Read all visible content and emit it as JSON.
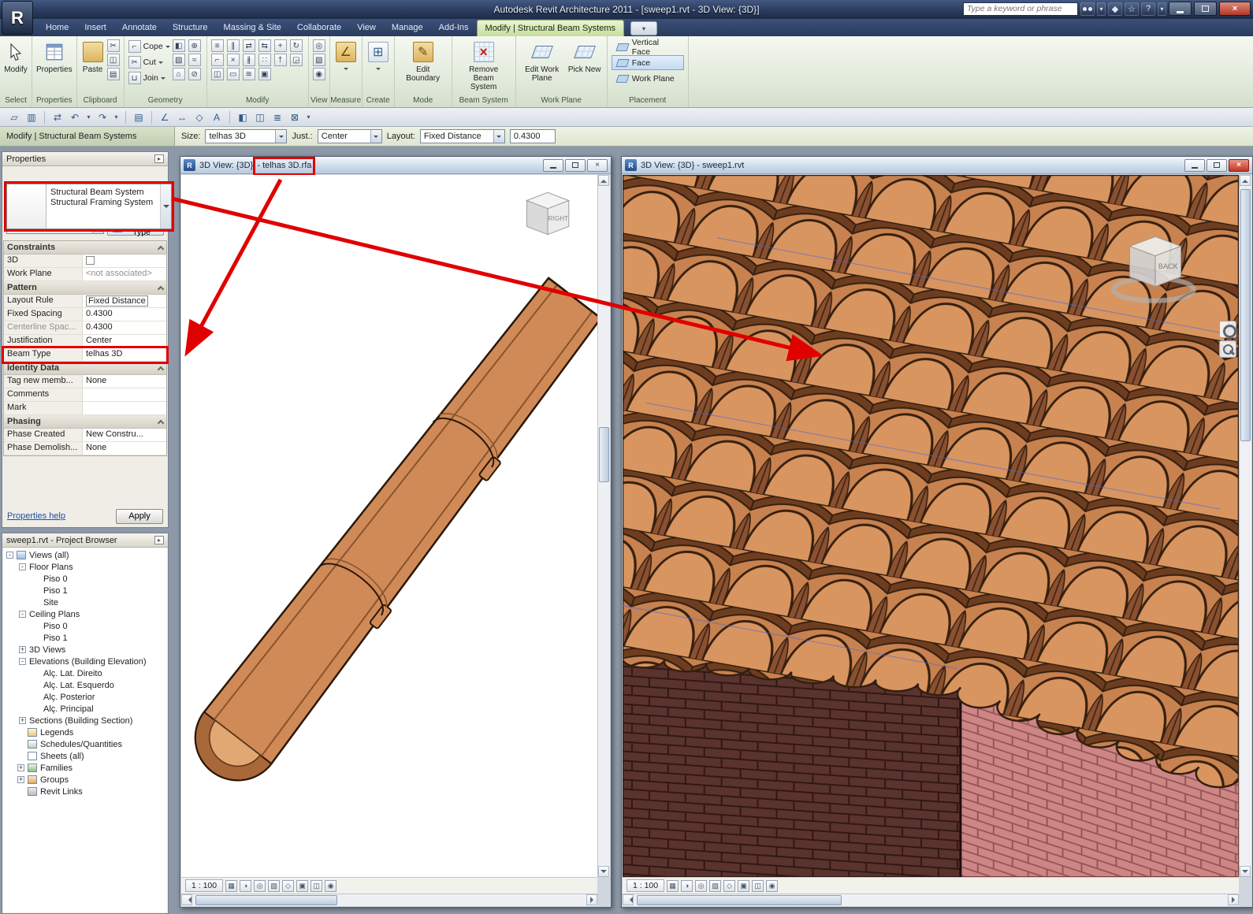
{
  "colors": {
    "annotation_red": "#e00000",
    "tab_active_green": "#c7dd9b",
    "tile_terracotta": "#cf8a57",
    "wall_dark": "#5a332e",
    "wall_pink": "#cd8585"
  },
  "titlebar": {
    "title": "Autodesk Revit Architecture 2011 - [sweep1.rvt - 3D View: {3D}]",
    "search_placeholder": "Type a keyword or phrase",
    "close_glyph": "×"
  },
  "titlebar_icons": [
    {
      "g": "",
      "n": "search-binoculars-icon",
      "cls": "tbi bino-box"
    },
    {
      "g": "▾",
      "n": "search-scope-dropdown-icon",
      "cls": "tbi tsm"
    },
    {
      "g": "◆",
      "n": "subscription-center-icon",
      "cls": "tbi"
    },
    {
      "g": "☆",
      "n": "favorites-icon",
      "cls": "tbi"
    },
    {
      "g": "?",
      "n": "help-icon",
      "cls": "tbi"
    },
    {
      "g": "▾",
      "n": "help-dropdown-icon",
      "cls": "tbi tsm"
    }
  ],
  "app_button": {
    "glyph": "R"
  },
  "tabs": [
    {
      "label": "Home",
      "cls": "tab",
      "n": "tab-home"
    },
    {
      "label": "Insert",
      "cls": "tab",
      "n": "tab-insert"
    },
    {
      "label": "Annotate",
      "cls": "tab",
      "n": "tab-annotate"
    },
    {
      "label": "Structure",
      "cls": "tab",
      "n": "tab-structure"
    },
    {
      "label": "Massing & Site",
      "cls": "tab",
      "n": "tab-massing-site"
    },
    {
      "label": "Collaborate",
      "cls": "tab",
      "n": "tab-collaborate"
    },
    {
      "label": "View",
      "cls": "tab",
      "n": "tab-view"
    },
    {
      "label": "Manage",
      "cls": "tab",
      "n": "tab-manage"
    },
    {
      "label": "Add-Ins",
      "cls": "tab",
      "n": "tab-add-ins"
    },
    {
      "label": "Modify | Structural Beam Systems",
      "cls": "tab active",
      "n": "tab-modify-structural-beam-systems"
    },
    {
      "label": "▾",
      "cls": "tabx",
      "n": "ribbon-display-toggle"
    }
  ],
  "ribbon": {
    "panels": {
      "select": "Select",
      "properties": "Properties",
      "clipboard": "Clipboard",
      "geometry": "Geometry",
      "modify": "Modify",
      "view": "View",
      "measure": "Measure",
      "create": "Create",
      "mode": "Mode",
      "beam_system": "Beam System",
      "work_plane": "Work Plane",
      "placement": "Placement"
    },
    "buttons": {
      "modify": "Modify",
      "properties": "Properties",
      "paste": "Paste",
      "cope": "Cope",
      "cut": "Cut",
      "join": "Join",
      "edit_boundary": "Edit Boundary",
      "remove_beam_system": "Remove Beam System",
      "edit_work_plane": "Edit Work Plane",
      "pick_new": "Pick New"
    },
    "glyphs": {
      "pencil": "✎",
      "remove_x": "×",
      "create": "⊞",
      "measure": "∠",
      "cope": "⌐",
      "cut": "✂",
      "join": "⊔"
    },
    "clipboard_icons": [
      {
        "g": "✂",
        "n": "cut-to-clipboard-icon"
      },
      {
        "g": "◫",
        "n": "copy-to-clipboard-icon"
      },
      {
        "g": "▤",
        "n": "match-type-properties-icon"
      }
    ],
    "geometry_icons": [
      {
        "g": "◧",
        "n": "paint-icon"
      },
      {
        "g": "⊕",
        "n": "join-geometry-icon"
      },
      {
        "g": "▨",
        "n": "demolish-icon"
      },
      {
        "g": "≈",
        "n": "split-face-icon"
      },
      {
        "g": "⌂",
        "n": "wall-joins-icon"
      },
      {
        "g": "⊘",
        "n": "unjoin-icon"
      }
    ],
    "modify_icons": [
      {
        "g": "≡",
        "n": "align-icon"
      },
      {
        "g": "∥",
        "n": "offset-icon"
      },
      {
        "g": "⇄",
        "n": "mirror-pick-axis-icon"
      },
      {
        "g": "⇆",
        "n": "mirror-draw-axis-icon"
      },
      {
        "g": "+",
        "n": "move-icon"
      },
      {
        "g": "↻",
        "n": "rotate-icon"
      },
      {
        "g": "⌐",
        "n": "trim-extend-icon"
      },
      {
        "g": "×",
        "n": "delete-icon"
      },
      {
        "g": "∦",
        "n": "split-element-icon"
      },
      {
        "g": "∷",
        "n": "array-icon"
      },
      {
        "g": "†",
        "n": "pin-icon"
      },
      {
        "g": "◲",
        "n": "scale-icon"
      },
      {
        "g": "◫",
        "n": "copy-icon"
      },
      {
        "g": "▭",
        "n": "unpin-icon"
      },
      {
        "g": "≋",
        "n": "match-icon"
      },
      {
        "g": "▣",
        "n": "activate-controls-icon"
      }
    ],
    "view_icons": [
      {
        "g": "◎",
        "n": "reveal-hidden-elements-icon"
      },
      {
        "g": "▨",
        "n": "hide-element-icon"
      },
      {
        "g": "◉",
        "n": "visibility-settings-icon"
      }
    ],
    "placement_options": [
      {
        "label": "Vertical Face",
        "cls": "place-item",
        "n": "placement-vertical-face"
      },
      {
        "label": "Face",
        "cls": "place-item selected",
        "n": "placement-face"
      },
      {
        "label": "Work Plane",
        "cls": "place-item",
        "n": "placement-work-plane"
      }
    ]
  },
  "qat_icons": [
    {
      "g": "▱",
      "n": "open-icon",
      "cls": "qi"
    },
    {
      "g": "▥",
      "n": "save-icon",
      "cls": "qi"
    },
    {
      "g": "",
      "n": "separator",
      "cls": "qsep"
    },
    {
      "g": "⇄",
      "n": "sync-with-central-icon",
      "cls": "qi"
    },
    {
      "g": "↶",
      "n": "undo-icon",
      "cls": "qi"
    },
    {
      "g": "▾",
      "n": "undo-dropdown-icon",
      "cls": "qi qdd"
    },
    {
      "g": "↷",
      "n": "redo-icon",
      "cls": "qi"
    },
    {
      "g": "▾",
      "n": "redo-dropdown-icon",
      "cls": "qi qdd"
    },
    {
      "g": "",
      "n": "separator",
      "cls": "qsep"
    },
    {
      "g": "▤",
      "n": "print-icon",
      "cls": "qi"
    },
    {
      "g": "",
      "n": "separator",
      "cls": "qsep"
    },
    {
      "g": "∠",
      "n": "measure-icon",
      "cls": "qi"
    },
    {
      "g": "↔",
      "n": "aligned-dimension-icon",
      "cls": "qi"
    },
    {
      "g": "◇",
      "n": "tag-by-category-icon",
      "cls": "qi"
    },
    {
      "g": "A",
      "n": "text-icon",
      "cls": "qi"
    },
    {
      "g": "",
      "n": "separator",
      "cls": "qsep"
    },
    {
      "g": "◧",
      "n": "default-3d-view-icon",
      "cls": "qi"
    },
    {
      "g": "◫",
      "n": "section-icon",
      "cls": "qi"
    },
    {
      "g": "≣",
      "n": "thin-lines-icon",
      "cls": "qi"
    },
    {
      "g": "⊠",
      "n": "close-hidden-windows-icon",
      "cls": "qi"
    },
    {
      "g": "▾",
      "n": "switch-windows-dropdown-icon",
      "cls": "qi qdd"
    }
  ],
  "options_bar": {
    "mode_label": "Modify | Structural Beam Systems",
    "size_label": "Size:",
    "size_value": "telhas 3D",
    "just_label": "Just.:",
    "just_value": "Center",
    "layout_label": "Layout:",
    "layout_value": "Fixed Distance",
    "spacing_value": "0.4300"
  },
  "properties_panel": {
    "header": "Properties",
    "type_family": "Structural Beam System",
    "type_name": "Structural Framing System",
    "selector_value": "Structural Beam Sys",
    "edit_type": "Edit Type",
    "help_link": "Properties help",
    "apply": "Apply",
    "groups": {
      "constraints": "Constraints",
      "pattern": "Pattern",
      "identity": "Identity Data",
      "phasing": "Phasing"
    },
    "rows": {
      "c3d": {
        "k": "3D",
        "v": ""
      },
      "work_plane": {
        "k": "Work Plane",
        "v": "<not associated>"
      },
      "layout_rule": {
        "k": "Layout Rule",
        "v": "Fixed Distance"
      },
      "fixed_spacing": {
        "k": "Fixed Spacing",
        "v": "0.4300"
      },
      "centerline": {
        "k": "Centerline Spac...",
        "v": "0.4300"
      },
      "justification": {
        "k": "Justification",
        "v": "Center"
      },
      "beam_type": {
        "k": "Beam Type",
        "v": "telhas 3D"
      },
      "tag_new": {
        "k": "Tag new memb...",
        "v": "None"
      },
      "comments": {
        "k": "Comments",
        "v": ""
      },
      "mark": {
        "k": "Mark",
        "v": ""
      },
      "phase_created": {
        "k": "Phase Created",
        "v": "New Constru..."
      },
      "phase_demo": {
        "k": "Phase Demolish...",
        "v": "None"
      }
    }
  },
  "project_browser": {
    "header": "sweep1.rvt - Project Browser",
    "items": [
      {
        "label": "Views (all)",
        "cls": "titem l0",
        "exp": "-",
        "icn": "ticn icn-views"
      },
      {
        "label": "Floor Plans",
        "cls": "titem l1",
        "exp": "-",
        "icn": "ticn none"
      },
      {
        "label": "Piso 0",
        "cls": "titem l2",
        "exp": "",
        "icn": "ticn none"
      },
      {
        "label": "Piso 1",
        "cls": "titem l2",
        "exp": "",
        "icn": "ticn none"
      },
      {
        "label": "Site",
        "cls": "titem l2",
        "exp": "",
        "icn": "ticn none"
      },
      {
        "label": "Ceiling Plans",
        "cls": "titem l1",
        "exp": "-",
        "icn": "ticn none"
      },
      {
        "label": "Piso 0",
        "cls": "titem l2",
        "exp": "",
        "icn": "ticn none"
      },
      {
        "label": "Piso 1",
        "cls": "titem l2",
        "exp": "",
        "icn": "ticn none"
      },
      {
        "label": "3D Views",
        "cls": "titem l1",
        "exp": "+",
        "icn": "ticn none"
      },
      {
        "label": "Elevations (Building Elevation)",
        "cls": "titem l1",
        "exp": "-",
        "icn": "ticn none"
      },
      {
        "label": "Alç. Lat. Direito",
        "cls": "titem l2",
        "exp": "",
        "icn": "ticn none"
      },
      {
        "label": "Alç. Lat. Esquerdo",
        "cls": "titem l2",
        "exp": "",
        "icn": "ticn none"
      },
      {
        "label": "Alç. Posterior",
        "cls": "titem l2",
        "exp": "",
        "icn": "ticn none"
      },
      {
        "label": "Alç. Principal",
        "cls": "titem l2",
        "exp": "",
        "icn": "ticn none"
      },
      {
        "label": "Sections (Building Section)",
        "cls": "titem l1",
        "exp": "+",
        "icn": "ticn none"
      },
      {
        "label": "Legends",
        "cls": "titem l0i",
        "exp": "",
        "icn": "ticn icn-leg"
      },
      {
        "label": "Schedules/Quantities",
        "cls": "titem l0i",
        "exp": "",
        "icn": "ticn icn-sched"
      },
      {
        "label": "Sheets (all)",
        "cls": "titem l0i",
        "exp": "",
        "icn": "ticn icn-sheet"
      },
      {
        "label": "Families",
        "cls": "titem l0i",
        "exp": "+",
        "icn": "ticn icn-fam"
      },
      {
        "label": "Groups",
        "cls": "titem l0i",
        "exp": "+",
        "icn": "ticn icn-grp"
      },
      {
        "label": "Revit Links",
        "cls": "titem l0i",
        "exp": "",
        "icn": "ticn icn-link"
      }
    ]
  },
  "windows": {
    "left": {
      "title_prefix": "3D View: {3D} ",
      "title_highlight": "- telhas 3D.rfa",
      "viewcube": "RIGHT",
      "scale": "1 : 100"
    },
    "right": {
      "title": "3D View: {3D} - sweep1.rvt",
      "viewcube": "BACK",
      "scale": "1 : 100"
    }
  },
  "view_control_icons": [
    {
      "g": "▦",
      "n": "detail-level-icon"
    },
    {
      "g": "◑",
      "n": "visual-style-icon"
    },
    {
      "g": "◎",
      "n": "sun-path-icon"
    },
    {
      "g": "▨",
      "n": "shadows-icon"
    },
    {
      "g": "◇",
      "n": "show-crop-icon"
    },
    {
      "g": "▣",
      "n": "crop-region-icon"
    },
    {
      "g": "◫",
      "n": "temporary-hide-isolate-icon"
    },
    {
      "g": "◉",
      "n": "reveal-hidden-elements-icon"
    }
  ]
}
